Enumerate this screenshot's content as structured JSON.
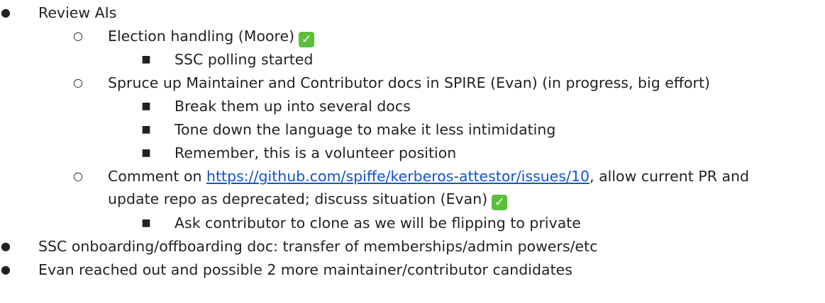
{
  "items": [
    {
      "level": 1,
      "text": "Review AIs"
    },
    {
      "level": 2,
      "text": "Election handling (Moore)",
      "check": true
    },
    {
      "level": 3,
      "text": "SSC polling started"
    },
    {
      "level": 2,
      "text": "Spruce up Maintainer and Contributor docs in SPIRE (Evan) (in progress, big effort)"
    },
    {
      "level": 3,
      "text": "Break them up into several docs"
    },
    {
      "level": 3,
      "text": "Tone down the language to make it less intimidating"
    },
    {
      "level": 3,
      "text": "Remember, this is a volunteer position"
    },
    {
      "level": 2,
      "text_before": "Comment on ",
      "link": "https://github.com/spiffe/kerberos-attestor/issues/10",
      "text_after": ", allow current PR and",
      "text_line2": "update repo as deprecated; discuss situation (Evan)",
      "check": true
    },
    {
      "level": 3,
      "text": "Ask contributor to clone as we will be flipping to private"
    },
    {
      "level": 1,
      "text": "SSC onboarding/offboarding doc: transfer of memberships/admin powers/etc"
    },
    {
      "level": 1,
      "text": "Evan reached out and possible 2 more maintainer/contributor candidates"
    }
  ],
  "markers": {
    "level1": "●",
    "level2": "○",
    "level3": "■"
  },
  "check_glyph": "✓",
  "colors": {
    "text": "#222222",
    "link": "#1155cc",
    "check_bg": "#5bbf3a"
  }
}
